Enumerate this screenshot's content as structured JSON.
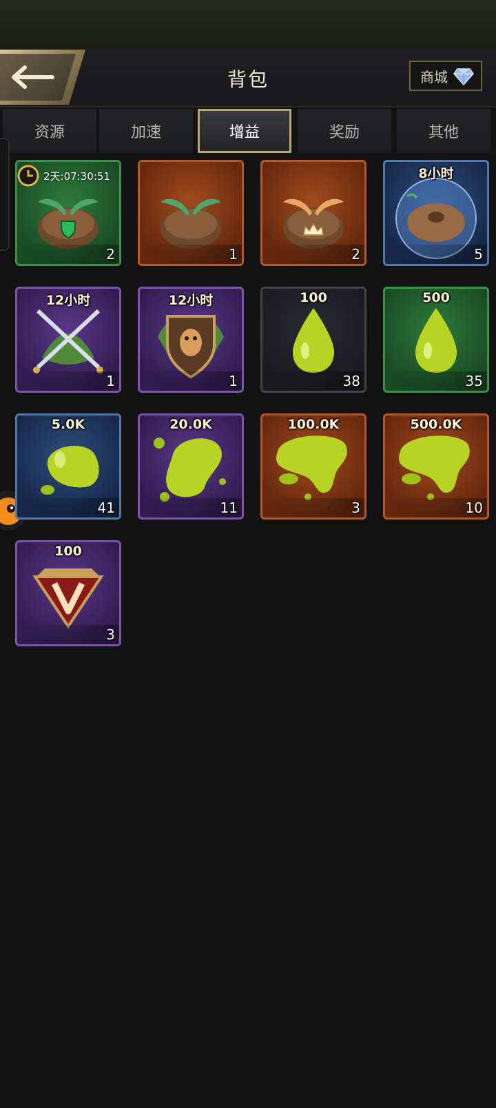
{
  "header": {
    "title": "背包",
    "shop_label": "商城"
  },
  "tabs": [
    {
      "label": "资源",
      "active": false
    },
    {
      "label": "加速",
      "active": false
    },
    {
      "label": "增益",
      "active": true
    },
    {
      "label": "奖励",
      "active": false
    },
    {
      "label": "其他",
      "active": false
    }
  ],
  "items": [
    {
      "icon": "seedling-shield-icon",
      "rarity": "green",
      "tag": "",
      "timer": "2天:07:30:51",
      "count": "2"
    },
    {
      "icon": "seedling-icon",
      "rarity": "orange",
      "tag": "",
      "timer": "",
      "count": "1"
    },
    {
      "icon": "golden-seedling-crown-icon",
      "rarity": "orange",
      "tag": "",
      "timer": "",
      "count": "2"
    },
    {
      "icon": "shield-bubble-icon",
      "rarity": "blue",
      "tag": "8小时",
      "timer": "",
      "count": "5"
    },
    {
      "icon": "crossed-swords-icon",
      "rarity": "purple",
      "tag": "12小时",
      "timer": "",
      "count": "1"
    },
    {
      "icon": "ant-shield-icon",
      "rarity": "purple",
      "tag": "12小时",
      "timer": "",
      "count": "1"
    },
    {
      "icon": "honeydew-drop-icon",
      "rarity": "dark",
      "tag": "100",
      "timer": "",
      "count": "38"
    },
    {
      "icon": "honeydew-drop-icon",
      "rarity": "green",
      "tag": "500",
      "timer": "",
      "count": "35"
    },
    {
      "icon": "honeydew-blob-icon",
      "rarity": "blue",
      "tag": "5.0K",
      "timer": "",
      "count": "41"
    },
    {
      "icon": "honeydew-splash-icon",
      "rarity": "purple",
      "tag": "20.0K",
      "timer": "",
      "count": "11"
    },
    {
      "icon": "honeydew-puddle-icon",
      "rarity": "orange",
      "tag": "100.0K",
      "timer": "",
      "count": "3"
    },
    {
      "icon": "honeydew-puddle-icon",
      "rarity": "orange",
      "tag": "500.0K",
      "timer": "",
      "count": "10"
    },
    {
      "icon": "vip-badge-icon",
      "rarity": "purple",
      "tag": "100",
      "timer": "",
      "count": "3"
    }
  ]
}
